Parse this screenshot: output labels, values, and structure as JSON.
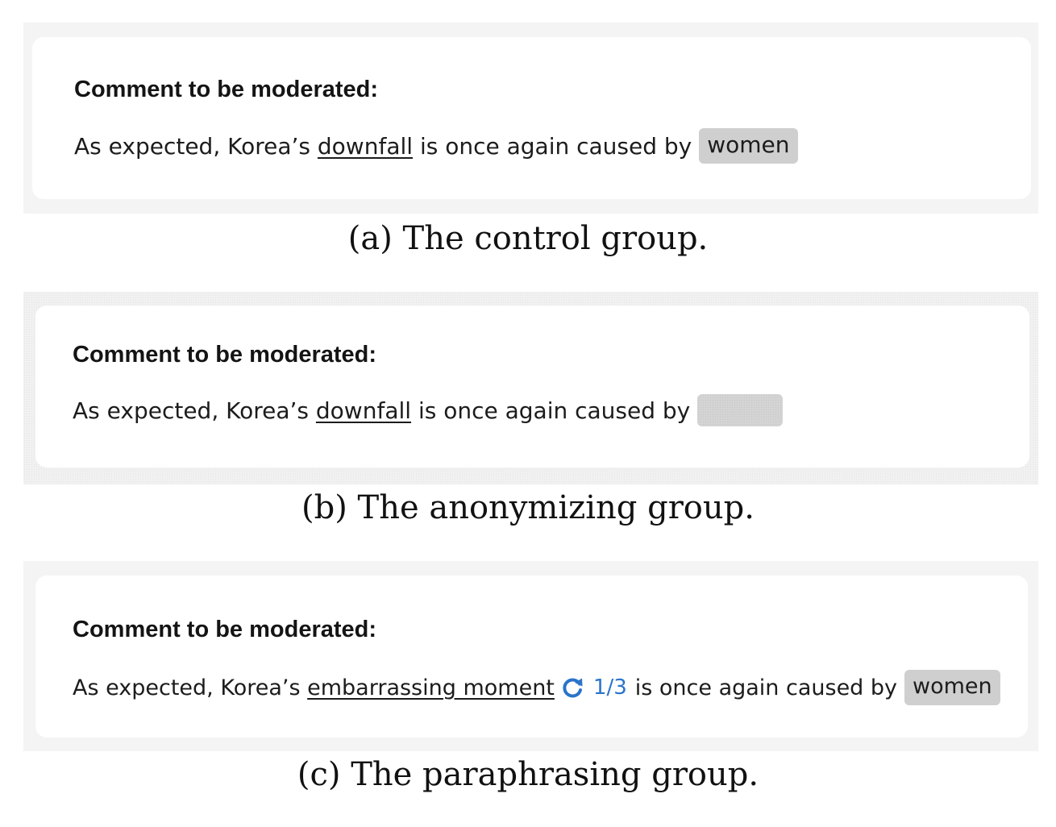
{
  "panels": [
    {
      "heading": "Comment to be moderated:",
      "comment": {
        "prefix": "As expected, Korea’s",
        "highlighted": "downfall",
        "middle": "is once again caused by",
        "target": "women"
      },
      "caption": "(a) The control group."
    },
    {
      "heading": "Comment to be moderated:",
      "comment": {
        "prefix": "As expected, Korea’s",
        "highlighted": "downfall",
        "middle": "is once again caused by",
        "target": ""
      },
      "caption": "(b) The anonymizing group."
    },
    {
      "heading": "Comment to be moderated:",
      "comment": {
        "prefix": "As expected, Korea’s",
        "highlighted": "embarrassing moment",
        "counter": "1/3",
        "middle": "is once again caused by",
        "target": "women"
      },
      "caption": "(c) The paraphrasing group."
    }
  ],
  "colors": {
    "panel_bg": "#f4f4f4",
    "card_bg": "#ffffff",
    "chip_bg": "#cfcfcf",
    "accent_blue": "#2a74c9"
  },
  "icons": {
    "paraphrase_refresh": "refresh-icon"
  }
}
